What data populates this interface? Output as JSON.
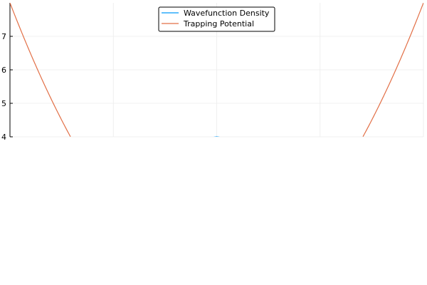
{
  "chart_data": {
    "type": "line",
    "title": "",
    "xlabel": "",
    "ylabel": "",
    "xlim": [
      -4,
      4
    ],
    "ylim": [
      4,
      8
    ],
    "y_ticks": [
      4,
      5,
      6,
      7
    ],
    "x_tick_count": 5,
    "grid": true,
    "legend_placement": "top-center",
    "colors": {
      "grid": "#ebebeb",
      "axis": "#000000",
      "legend_border": "#000000"
    },
    "series": [
      {
        "name": "Wavefunction Density",
        "color": "#009af9",
        "x": [
          -0.1,
          -0.05,
          0.0,
          0.05,
          0.1
        ],
        "y": [
          3.96,
          3.99,
          4.0,
          3.99,
          3.96
        ]
      },
      {
        "name": "Trapping Potential",
        "color": "#e26f46",
        "x": [
          -4.0,
          -3.6,
          -3.2,
          -2.8,
          -2.83,
          2.83,
          2.9,
          3.2,
          3.6,
          4.0
        ],
        "y": [
          8.0,
          6.48,
          5.12,
          3.92,
          4.0,
          4.0,
          4.21,
          5.12,
          6.48,
          8.0
        ]
      }
    ]
  }
}
